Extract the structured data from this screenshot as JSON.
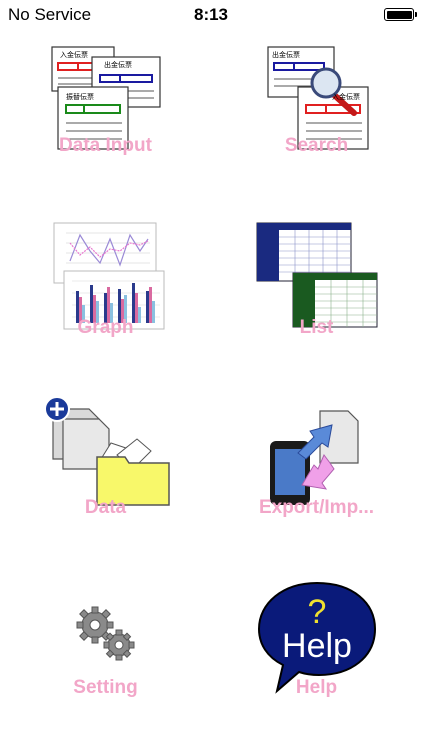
{
  "status_bar": {
    "carrier": "No Service",
    "time": "8:13",
    "battery_level_percent": 100
  },
  "menu": {
    "items": [
      {
        "label": "Data Input",
        "icon": "input-slips-icon"
      },
      {
        "label": "Search",
        "icon": "search-slips-icon"
      },
      {
        "label": "Graph",
        "icon": "graph-icon"
      },
      {
        "label": "List",
        "icon": "list-table-icon"
      },
      {
        "label": "Data",
        "icon": "data-folder-icon"
      },
      {
        "label": "Export/Imp...",
        "icon": "export-import-icon"
      },
      {
        "label": "Setting",
        "icon": "gears-icon"
      },
      {
        "label": "Help",
        "icon": "help-bubble-icon"
      }
    ],
    "label_color": "#f2a6c8"
  },
  "slips": {
    "receipt": "入金伝票",
    "payment": "出金伝票",
    "transfer": "振替伝票"
  },
  "help_bubble": {
    "mark": "?",
    "text": "Help"
  }
}
